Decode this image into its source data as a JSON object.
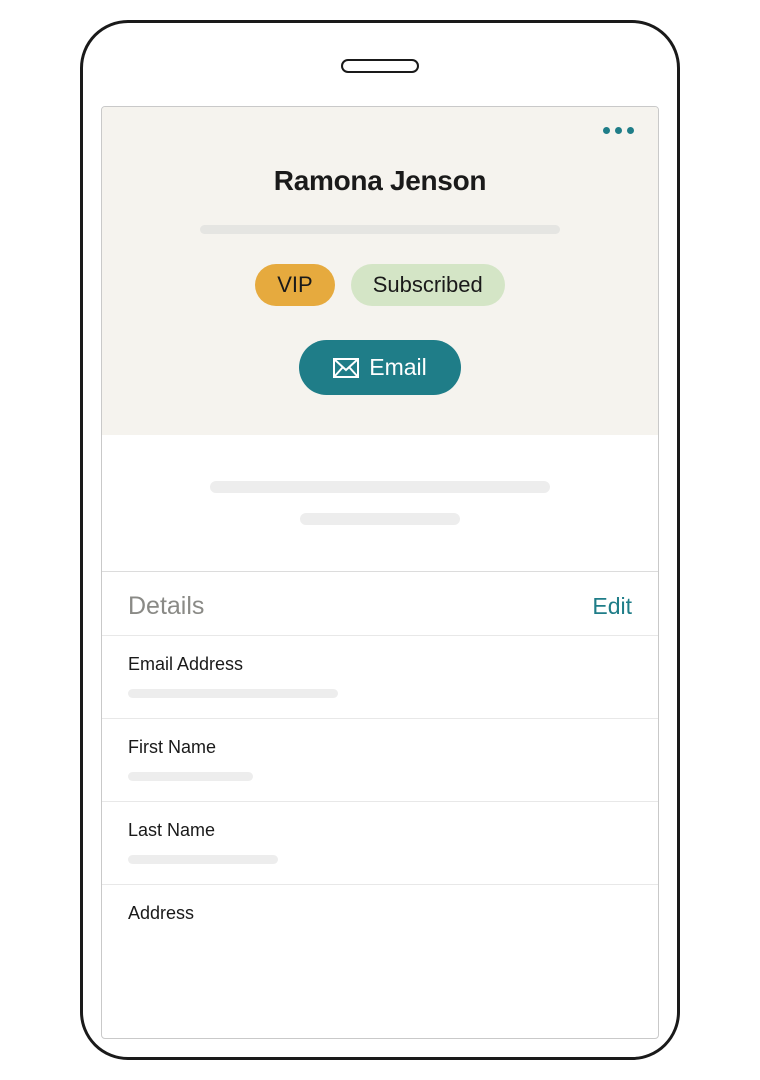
{
  "header": {
    "contact_name": "Ramona Jenson",
    "tags": {
      "vip": "VIP",
      "subscribed": "Subscribed"
    },
    "email_button": "Email"
  },
  "details": {
    "section_title": "Details",
    "edit_label": "Edit",
    "fields": {
      "email": "Email Address",
      "first_name": "First Name",
      "last_name": "Last Name",
      "address": "Address"
    }
  },
  "colors": {
    "accent": "#1f7d88",
    "vip_tag": "#e6aa3e",
    "subscribed_tag": "#d4e5c6",
    "header_bg": "#f5f3ee"
  }
}
